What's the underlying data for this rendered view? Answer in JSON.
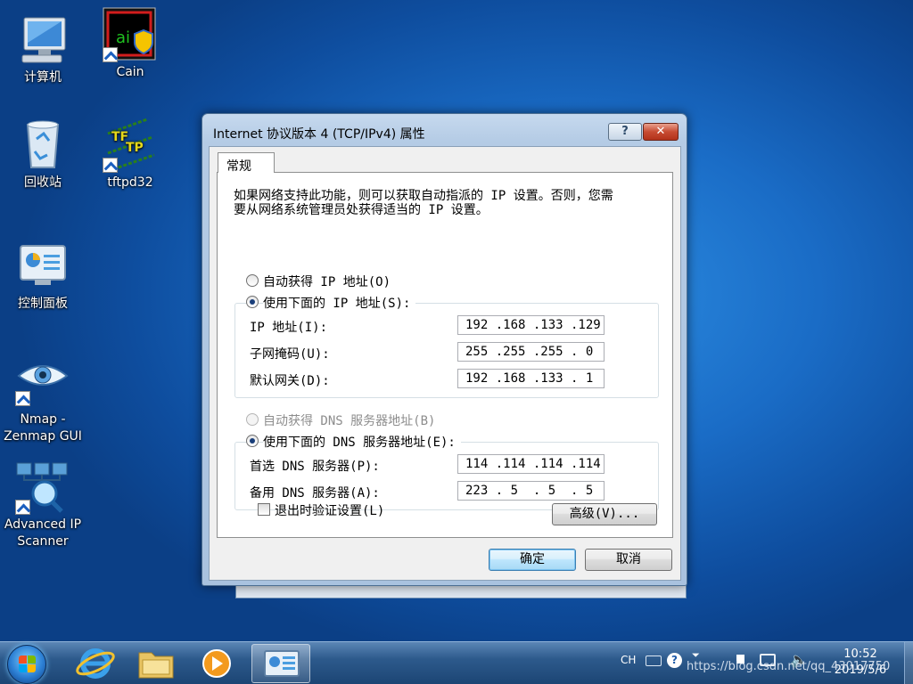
{
  "desktop": {
    "icons": [
      {
        "label": "计算机"
      },
      {
        "label": "Cain"
      },
      {
        "label": "回收站"
      },
      {
        "label": "tftpd32"
      },
      {
        "label": "控制面板"
      },
      {
        "label": "Nmap -",
        "label2": "Zenmap GUI"
      },
      {
        "label": "Advanced IP",
        "label2": "Scanner"
      }
    ]
  },
  "dialog": {
    "title": "Internet 协议版本 4 (TCP/IPv4) 属性",
    "help_label": "?",
    "close_label": "✕",
    "tab": "常规",
    "description_line1": "如果网络支持此功能，则可以获取自动指派的 IP 设置。否则，您需",
    "description_line2": "要从网络系统管理员处获得适当的 IP 设置。",
    "ip": {
      "auto_label": "自动获得 IP 地址(O)",
      "auto_selected": false,
      "manual_label": "使用下面的 IP 地址(S):",
      "manual_selected": true,
      "fields": [
        {
          "label": "IP 地址(I):",
          "value": "192 .168 .133 .129"
        },
        {
          "label": "子网掩码(U):",
          "value": "255 .255 .255 . 0"
        },
        {
          "label": "默认网关(D):",
          "value": "192 .168 .133 . 1"
        }
      ]
    },
    "dns": {
      "auto_label": "自动获得 DNS 服务器地址(B)",
      "auto_selected": false,
      "auto_disabled": true,
      "manual_label": "使用下面的 DNS 服务器地址(E):",
      "manual_selected": true,
      "fields": [
        {
          "label": "首选 DNS 服务器(P):",
          "value": "114 .114 .114 .114"
        },
        {
          "label": "备用 DNS 服务器(A):",
          "value": "223 . 5  . 5  . 5"
        }
      ]
    },
    "validate_label": "退出时验证设置(L)",
    "validate_checked": false,
    "advanced_label": "高级(V)...",
    "ok_label": "确定",
    "cancel_label": "取消"
  },
  "taskbar": {
    "lang": "CH",
    "time": "10:52",
    "date": "2019/5/6",
    "pinned": [
      "internet-explorer",
      "windows-explorer",
      "media-player",
      "control-panel"
    ],
    "active": "control-panel"
  },
  "watermark": "https://blog.csdn.net/qq_43017750",
  "colors": {
    "accent": "#1a6cc6",
    "close": "#c74b32"
  }
}
